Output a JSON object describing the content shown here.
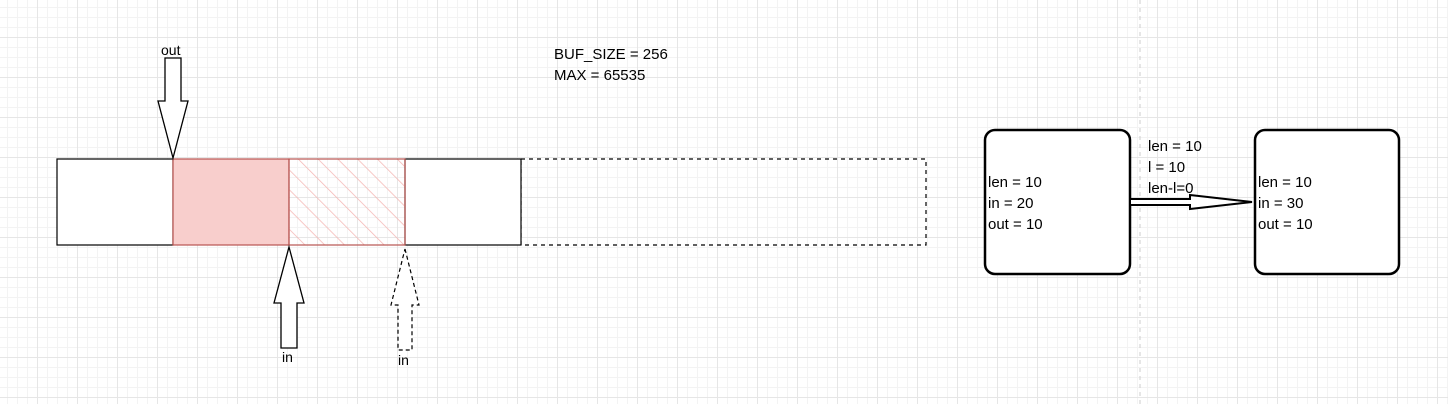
{
  "colors": {
    "highlight_fill": "#f8cecc",
    "highlight_stroke": "#b85450",
    "hatch_stroke": "#f4b6b3",
    "line": "#000000",
    "dashed_divider": "#cccccc"
  },
  "buffer": {
    "out_label": "out",
    "in_label": "in",
    "in_next_label": "in"
  },
  "constants": {
    "lines": [
      "BUF_SIZE = 256",
      "MAX = 65535"
    ]
  },
  "state_before": {
    "lines": [
      "len = 10",
      "in = 20",
      "out = 10"
    ]
  },
  "transition": {
    "lines": [
      "len = 10",
      "l = 10",
      "len-l=0"
    ]
  },
  "state_after": {
    "lines": [
      "len = 10",
      "in = 30",
      "out = 10"
    ]
  }
}
